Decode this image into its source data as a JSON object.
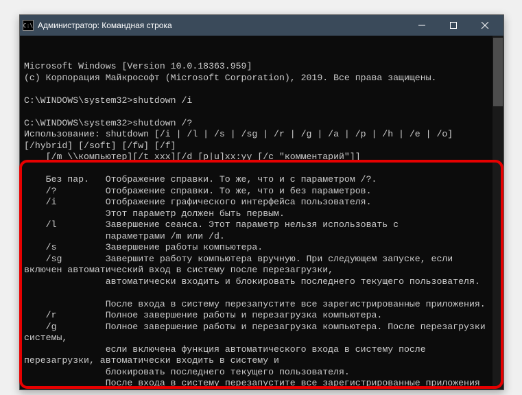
{
  "titlebar": {
    "icon_text": "C:\\",
    "title": "Администратор: Командная строка",
    "minimize": "─",
    "maximize": "☐",
    "close": "✕"
  },
  "terminal": {
    "version_line": "Microsoft Windows [Version 10.0.18363.959]",
    "copyright_line": "(c) Корпорация Майкрософт (Microsoft Corporation), 2019. Все права защищены.",
    "prompt1": "C:\\WINDOWS\\system32>shutdown /i",
    "prompt2": "C:\\WINDOWS\\system32>shutdown /?",
    "usage_line1": "Использование: shutdown [/i | /l | /s | /sg | /r | /g | /a | /p | /h | /e | /o] [/hybrid] [/soft] [/fw] [/f]",
    "usage_line2": "    [/m \\\\компьютер][/t xxx][/d [p|u]xx:yy [/c \"комментарий\"]]",
    "help_nopar": "    Без пар.   Отображение справки. То же, что и с параметром /?.",
    "help_q": "    /?         Отображение справки. То же, что и без параметров.",
    "help_i1": "    /i         Отображение графического интерфейса пользователя.",
    "help_i2": "               Этот параметр должен быть первым.",
    "help_l1": "    /l         Завершение сеанса. Этот параметр нельзя использовать с",
    "help_l2": "               параметрами /m или /d.",
    "help_s": "    /s         Завершение работы компьютера.",
    "help_sg1": "    /sg        Завершите работу компьютера вручную. При следующем запуске, если включен автоматический вход в систему после перезагрузки,",
    "help_sg2": "               автоматически входить и блокировать последнего текущего пользователя.",
    "help_sg3": "               После входа в систему перезапустите все зарегистрированные приложения.",
    "help_r": "    /r         Полное завершение работы и перезагрузка компьютера.",
    "help_g1": "    /g         Полное завершение работы и перезагрузка компьютера. После перезагрузки системы,",
    "help_g2": "               если включена функция автоматического входа в систему после перезагрузки, автоматически входить в систему и",
    "help_g3": "               блокировать последнего текущего пользователя.",
    "help_g4": "               После входа в систему перезапустите все зарегистрированные приложения"
  }
}
